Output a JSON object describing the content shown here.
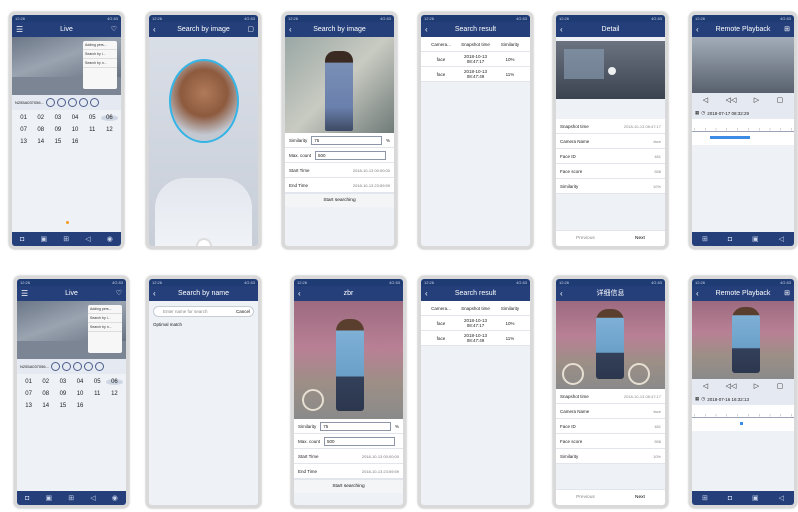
{
  "status": {
    "time": "12:26",
    "icons": "4G 83"
  },
  "row1": {
    "live": {
      "title": "Live",
      "cam_menu": [
        "Adding pers...",
        "Search by i...",
        "Search by n..."
      ],
      "device": "N255A037056...",
      "channels": [
        "01",
        "02",
        "03",
        "04",
        "05",
        "06",
        "07",
        "08",
        "09",
        "10",
        "11",
        "12",
        "13",
        "14",
        "15",
        "16"
      ],
      "selected_channel": "06"
    },
    "search_by_image_camera": {
      "title": "Search by image"
    },
    "search_by_image_form": {
      "title": "Search by image",
      "similarity_label": "Similarity",
      "similarity_value": "75",
      "similarity_unit": "%",
      "maxcount_label": "Max. count",
      "maxcount_value": "500",
      "start_label": "Start Time",
      "start_value": "2018-10-13 00:00:00",
      "end_label": "End Time",
      "end_value": "2018-10-13 23:59:59",
      "button": "Start searching"
    },
    "search_result": {
      "title": "Search result",
      "headers": [
        "Camera...",
        "Snapshot time",
        "Similarity"
      ],
      "rows": [
        {
          "cam": "face",
          "time": "2018-10-13 08:47:17",
          "sim": "10%"
        },
        {
          "cam": "face",
          "time": "2018-10-13 08:47:49",
          "sim": "11%"
        }
      ]
    },
    "detail": {
      "title": "Detail",
      "fields": [
        {
          "k": "Snapshot time",
          "v": "2018-10-13 08:47:17"
        },
        {
          "k": "Camera Name",
          "v": "face"
        },
        {
          "k": "Face ID",
          "v": "481"
        },
        {
          "k": "Face score",
          "v": "558"
        },
        {
          "k": "Similarity",
          "v": "10%"
        }
      ],
      "prev": "Previous",
      "next": "Next"
    },
    "playback": {
      "title": "Remote Playback",
      "datetime": "2018-07-17 08:32:29"
    }
  },
  "row2": {
    "live": {
      "title": "Live",
      "device": "N255A037056..."
    },
    "search_by_name": {
      "title": "Search by name",
      "placeholder": "Enter name for search",
      "cancel": "Cancel",
      "optimal": "Optimal match"
    },
    "form2": {
      "title": "zbr",
      "similarity_value": "75",
      "maxcount_value": "500",
      "start_value": "2018-10-13 00:00:00",
      "end_value": "2018-10-13 23:59:59"
    },
    "detail2": {
      "title": "详细信息",
      "fields": [
        {
          "k": "Snapshot time",
          "v": "2018-10-13 08:47:17"
        },
        {
          "k": "Camera Name",
          "v": "face"
        },
        {
          "k": "Face ID",
          "v": "481"
        },
        {
          "k": "Face score",
          "v": "558"
        },
        {
          "k": "Similarity",
          "v": "10%"
        }
      ]
    },
    "playback2": {
      "title": "Remote Playback",
      "datetime": "2018-07-16 16:32:13"
    }
  }
}
